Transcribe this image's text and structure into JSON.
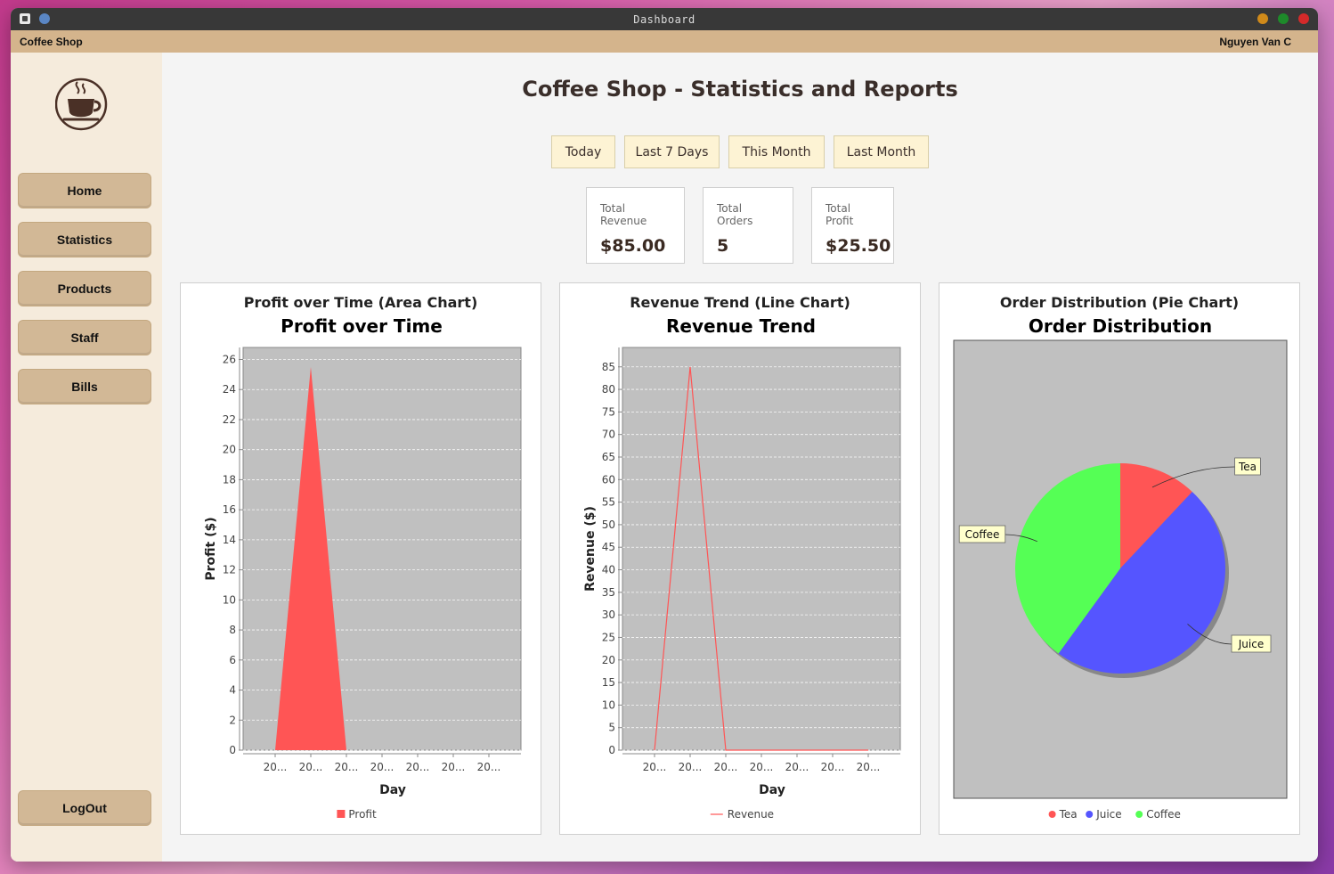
{
  "window": {
    "title": "Dashboard"
  },
  "menubar": {
    "app_name": "Coffee Shop",
    "user": "Nguyen Van C"
  },
  "sidebar": {
    "items": [
      {
        "label": "Home"
      },
      {
        "label": "Statistics"
      },
      {
        "label": "Products"
      },
      {
        "label": "Staff"
      },
      {
        "label": "Bills"
      }
    ],
    "logout_label": "LogOut"
  },
  "main": {
    "title": "Coffee Shop - Statistics and Reports",
    "ranges": [
      "Today",
      "Last 7 Days",
      "This Month",
      "Last Month"
    ],
    "stats": [
      {
        "label": "Total Revenue",
        "value": "$85.00"
      },
      {
        "label": "Total Orders",
        "value": "5"
      },
      {
        "label": "Total Profit",
        "value": "$25.50"
      }
    ]
  },
  "colors": {
    "profit": "#ff5555",
    "tea": "#ff5555",
    "juice": "#5555ff",
    "coffee": "#55ff55",
    "plot_bg": "#c0c0c0"
  },
  "chart_data": [
    {
      "type": "area",
      "panel_title": "Profit over Time (Area Chart)",
      "title": "Profit over Time",
      "xlabel": "Day",
      "ylabel": "Profit ($)",
      "categories": [
        "20...",
        "20...",
        "20...",
        "20...",
        "20...",
        "20...",
        "20..."
      ],
      "series": [
        {
          "name": "Profit",
          "values": [
            0,
            25.5,
            0,
            0,
            0,
            0,
            0
          ]
        }
      ],
      "ylim": [
        0,
        26.8
      ],
      "yticks": [
        0,
        2,
        4,
        6,
        8,
        10,
        12,
        14,
        16,
        18,
        20,
        22,
        24,
        26
      ],
      "grid": true,
      "legend": "bottom"
    },
    {
      "type": "line",
      "panel_title": "Revenue Trend (Line Chart)",
      "title": "Revenue Trend",
      "xlabel": "Day",
      "ylabel": "Revenue ($)",
      "categories": [
        "20...",
        "20...",
        "20...",
        "20...",
        "20...",
        "20...",
        "20..."
      ],
      "series": [
        {
          "name": "Revenue",
          "values": [
            0,
            85,
            0,
            0,
            0,
            0,
            0
          ]
        }
      ],
      "ylim": [
        0,
        89.3
      ],
      "yticks": [
        0,
        5,
        10,
        15,
        20,
        25,
        30,
        35,
        40,
        45,
        50,
        55,
        60,
        65,
        70,
        75,
        80,
        85
      ],
      "grid": true,
      "legend": "bottom"
    },
    {
      "type": "pie",
      "panel_title": "Order Distribution (Pie Chart)",
      "title": "Order Distribution",
      "slices": [
        {
          "name": "Tea",
          "value": 0.6
        },
        {
          "name": "Juice",
          "value": 2.4
        },
        {
          "name": "Coffee",
          "value": 2.0
        }
      ],
      "legend": "bottom"
    }
  ]
}
